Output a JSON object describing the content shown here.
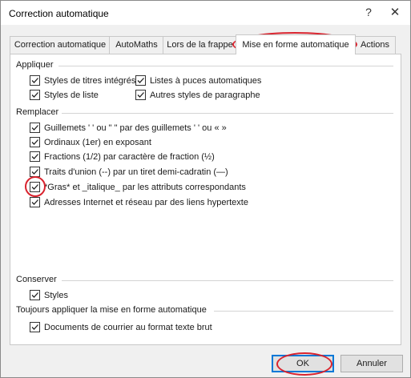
{
  "window": {
    "title": "Correction automatique",
    "help_label": "?",
    "close_label": "✕"
  },
  "tabs": [
    {
      "label": "Correction automatique"
    },
    {
      "label": "AutoMaths"
    },
    {
      "label": "Lors de la frappe"
    },
    {
      "label": "Mise en forme automatique",
      "active": true
    },
    {
      "label": "Actions"
    }
  ],
  "sections": {
    "appliquer": "Appliquer",
    "remplacer": "Remplacer",
    "conserver": "Conserver",
    "toujours": "Toujours appliquer la mise en forme automatique"
  },
  "appliquer_options": [
    {
      "label": "Styles de titres intégrés",
      "checked": true
    },
    {
      "label": "Listes à puces automatiques",
      "checked": true
    },
    {
      "label": "Styles de liste",
      "checked": true
    },
    {
      "label": "Autres styles de paragraphe",
      "checked": true
    }
  ],
  "remplacer_options": [
    {
      "label": "Guillemets ' ' ou \" \" par des guillemets ' ' ou « »",
      "checked": true
    },
    {
      "label": "Ordinaux (1er) en exposant",
      "checked": true
    },
    {
      "label": "Fractions (1/2) par caractère de fraction (½)",
      "checked": true
    },
    {
      "label": "Traits d'union (--) par un tiret demi-cadratin (—)",
      "checked": true
    },
    {
      "label": "*Gras* et _italique_ par les attributs correspondants",
      "checked": true
    },
    {
      "label": "Adresses Internet et réseau par des liens hypertexte",
      "checked": true
    }
  ],
  "conserver_options": [
    {
      "label": "Styles",
      "checked": true
    }
  ],
  "toujours_options": [
    {
      "label": "Documents de courrier au format texte brut",
      "checked": true
    }
  ],
  "buttons": {
    "ok": "OK",
    "cancel": "Annuler"
  },
  "colors": {
    "annotation_red": "#d9232e",
    "focus_blue": "#0078d7"
  }
}
